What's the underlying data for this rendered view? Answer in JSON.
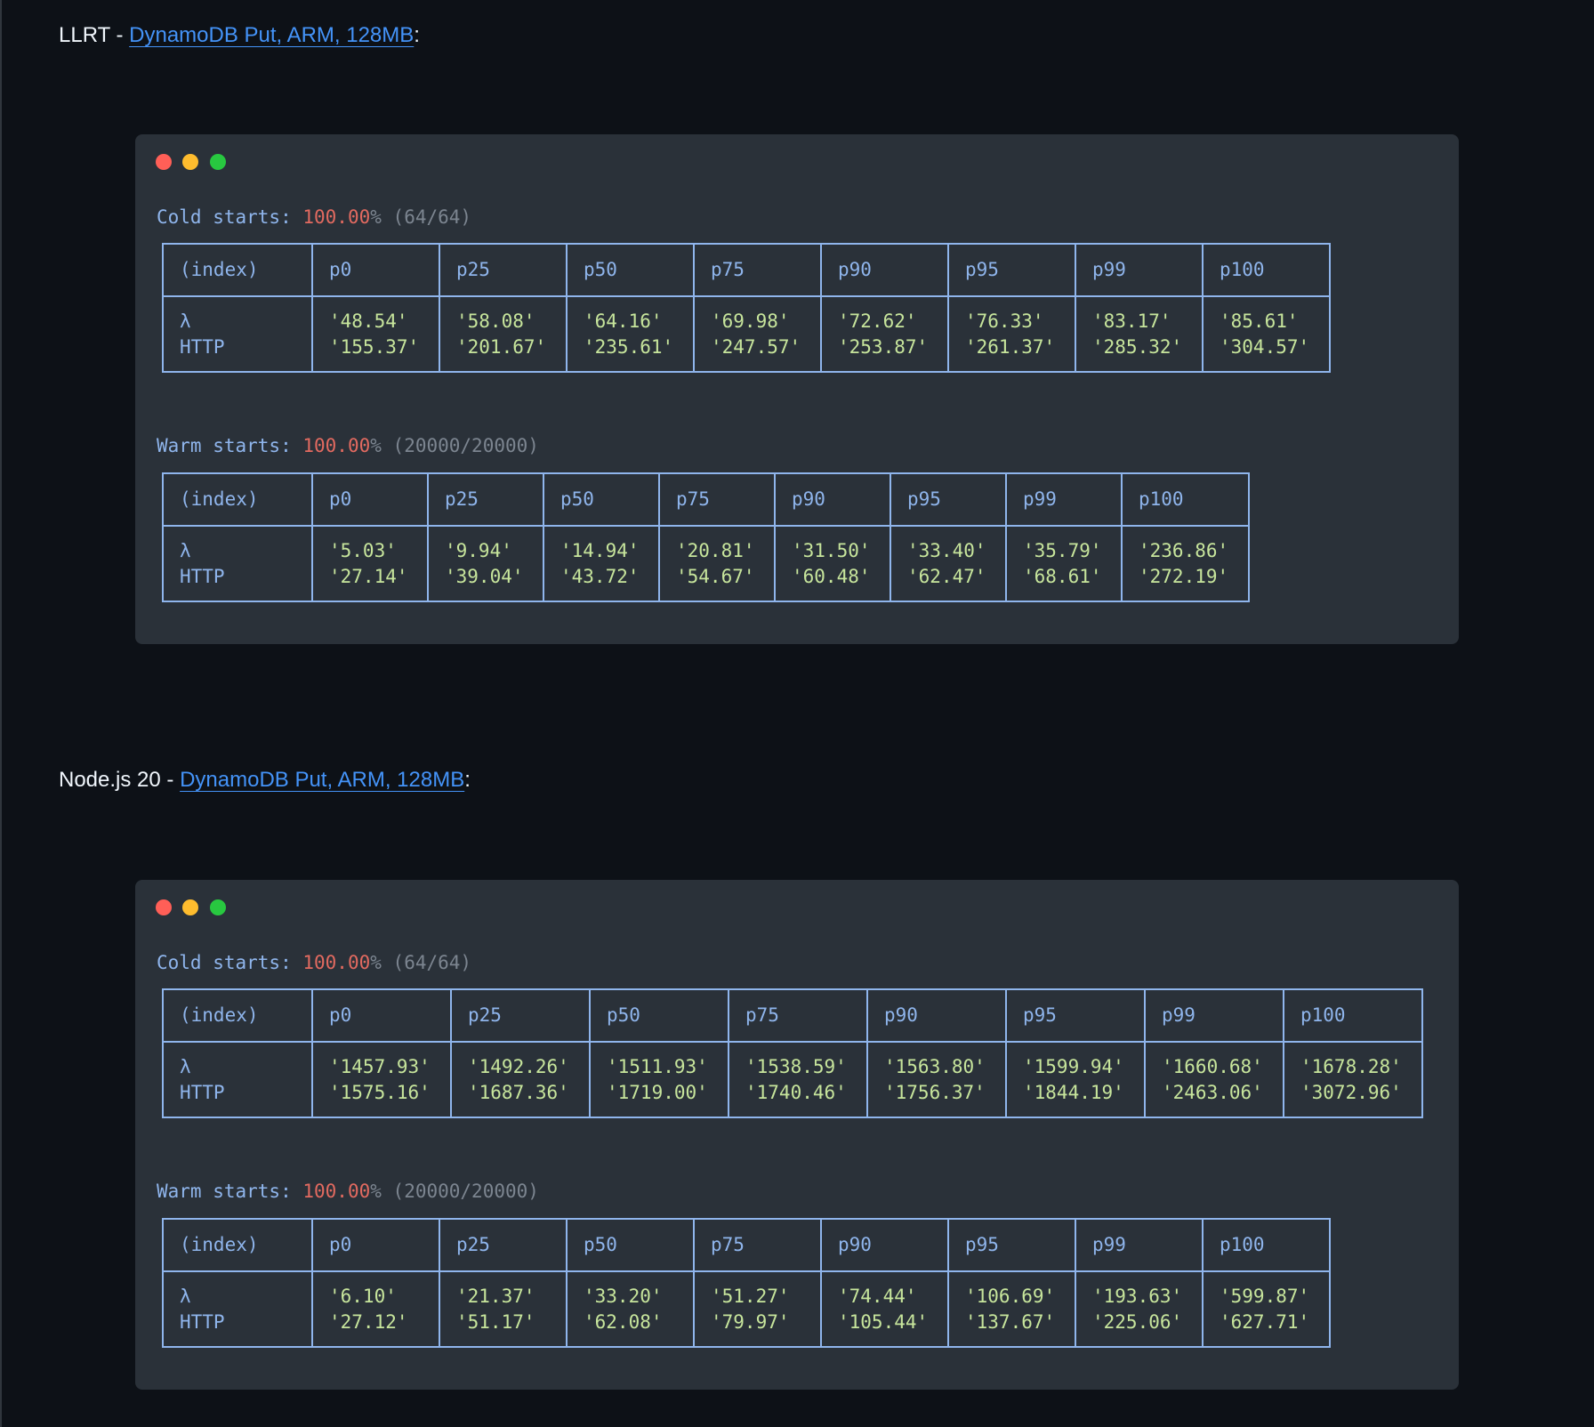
{
  "sections": [
    {
      "heading_prefix": "LLRT - ",
      "heading_link": "DynamoDB Put, ARM, 128MB",
      "heading_suffix": ":",
      "blocks": [
        {
          "label": "Cold starts:",
          "percent": "100.00",
          "percent_sign": "%",
          "count": "(64/64)",
          "headers": [
            "(index)",
            "p0",
            "p25",
            "p50",
            "p75",
            "p90",
            "p95",
            "p99",
            "p100"
          ],
          "rows": [
            [
              "λ",
              "'48.54'",
              "'58.08'",
              "'64.16'",
              "'69.98'",
              "'72.62'",
              "'76.33'",
              "'83.17'",
              "'85.61'"
            ],
            [
              "HTTP",
              "'155.37'",
              "'201.67'",
              "'235.61'",
              "'247.57'",
              "'253.87'",
              "'261.37'",
              "'285.32'",
              "'304.57'"
            ]
          ]
        },
        {
          "label": "Warm starts:",
          "percent": "100.00",
          "percent_sign": "%",
          "count": "(20000/20000)",
          "headers": [
            "(index)",
            "p0",
            "p25",
            "p50",
            "p75",
            "p90",
            "p95",
            "p99",
            "p100"
          ],
          "rows": [
            [
              "λ",
              "'5.03'",
              "'9.94'",
              "'14.94'",
              "'20.81'",
              "'31.50'",
              "'33.40'",
              "'35.79'",
              "'236.86'"
            ],
            [
              "HTTP",
              "'27.14'",
              "'39.04'",
              "'43.72'",
              "'54.67'",
              "'60.48'",
              "'62.47'",
              "'68.61'",
              "'272.19'"
            ]
          ]
        }
      ]
    },
    {
      "heading_prefix": "Node.js 20 - ",
      "heading_link": "DynamoDB Put, ARM, 128MB",
      "heading_suffix": ":",
      "blocks": [
        {
          "label": "Cold starts:",
          "percent": "100.00",
          "percent_sign": "%",
          "count": "(64/64)",
          "headers": [
            "(index)",
            "p0",
            "p25",
            "p50",
            "p75",
            "p90",
            "p95",
            "p99",
            "p100"
          ],
          "rows": [
            [
              "λ",
              "'1457.93'",
              "'1492.26'",
              "'1511.93'",
              "'1538.59'",
              "'1563.80'",
              "'1599.94'",
              "'1660.68'",
              "'1678.28'"
            ],
            [
              "HTTP",
              "'1575.16'",
              "'1687.36'",
              "'1719.00'",
              "'1740.46'",
              "'1756.37'",
              "'1844.19'",
              "'2463.06'",
              "'3072.96'"
            ]
          ]
        },
        {
          "label": "Warm starts:",
          "percent": "100.00",
          "percent_sign": "%",
          "count": "(20000/20000)",
          "headers": [
            "(index)",
            "p0",
            "p25",
            "p50",
            "p75",
            "p90",
            "p95",
            "p99",
            "p100"
          ],
          "rows": [
            [
              "λ",
              "'6.10'",
              "'21.37'",
              "'33.20'",
              "'51.27'",
              "'74.44'",
              "'106.69'",
              "'193.63'",
              "'599.87'"
            ],
            [
              "HTTP",
              "'27.12'",
              "'51.17'",
              "'62.08'",
              "'79.97'",
              "'105.44'",
              "'137.67'",
              "'225.06'",
              "'627.71'"
            ]
          ]
        }
      ]
    }
  ]
}
